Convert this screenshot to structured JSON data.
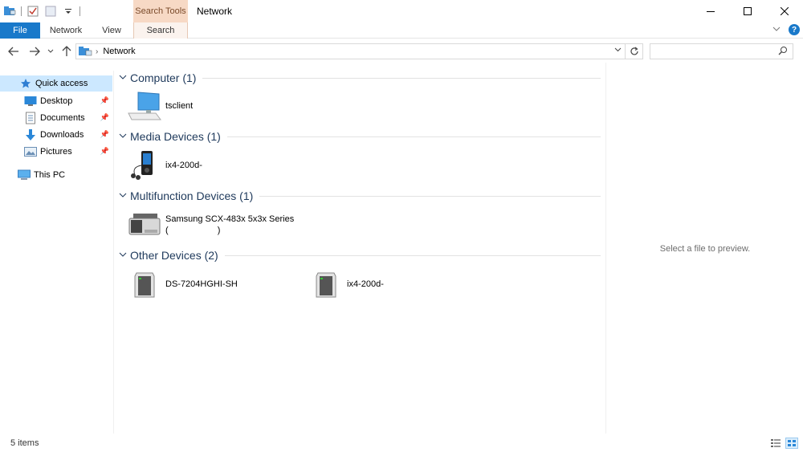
{
  "window": {
    "title": "Network",
    "context_tab_group": "Search Tools",
    "controls": [
      "minimize-icon",
      "maximize-icon",
      "close-icon"
    ]
  },
  "ribbon": {
    "tabs": [
      {
        "label": "File"
      },
      {
        "label": "Network"
      },
      {
        "label": "View"
      },
      {
        "label": "Search"
      }
    ],
    "help": "?"
  },
  "address_bar": {
    "breadcrumbs": [
      "Network"
    ],
    "search_placeholder": ""
  },
  "sidebar": {
    "quick_access": "Quick access",
    "items": [
      {
        "label": "Desktop",
        "icon": "desktop-icon",
        "pinned": true
      },
      {
        "label": "Documents",
        "icon": "documents-icon",
        "pinned": true
      },
      {
        "label": "Downloads",
        "icon": "downloads-icon",
        "pinned": true
      },
      {
        "label": "Pictures",
        "icon": "pictures-icon",
        "pinned": true
      }
    ],
    "this_pc": "This PC"
  },
  "groups": [
    {
      "title": "Computer (1)",
      "items": [
        {
          "label": "tsclient",
          "icon": "computer-icon"
        }
      ]
    },
    {
      "title": "Media Devices (1)",
      "items": [
        {
          "label": "ix4-200d-",
          "icon": "media-player-icon"
        }
      ]
    },
    {
      "title": "Multifunction Devices (1)",
      "items": [
        {
          "label": "Samsung SCX-483x 5x3x Series",
          "label2": "(                    )",
          "icon": "printer-icon"
        }
      ]
    },
    {
      "title": "Other Devices (2)",
      "items": [
        {
          "label": "DS-7204HGHI-SH",
          "icon": "network-device-icon"
        },
        {
          "label": "ix4-200d-",
          "icon": "network-device-icon"
        }
      ]
    }
  ],
  "preview": {
    "text": "Select a file to preview."
  },
  "status": {
    "count": "5 items"
  },
  "colors": {
    "accent": "#1979ca",
    "selection": "#cce8ff",
    "context_tab": "#f7d9c5",
    "group_header": "#1e395b"
  }
}
